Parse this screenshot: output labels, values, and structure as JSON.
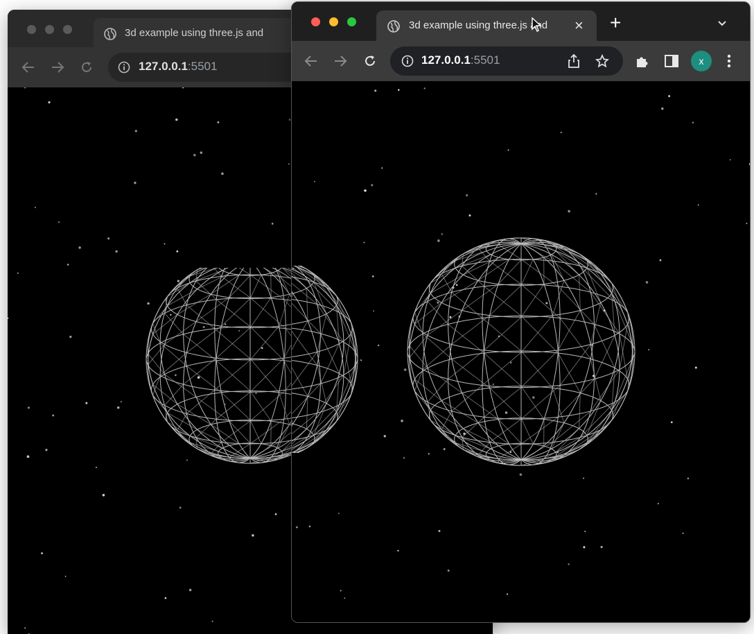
{
  "windows": {
    "back": {
      "tab_title": "3d example using three.js and",
      "url_host": "127.0.0.1",
      "url_port": ":5501"
    },
    "front": {
      "tab_title": "3d example using three.js and",
      "tab_close_glyph": "×",
      "new_tab_glyph": "+",
      "url_host": "127.0.0.1",
      "url_port": ":5501",
      "profile_initial": "x"
    }
  },
  "colors": {
    "close": "#ff5f57",
    "minimize": "#febc2e",
    "maximize": "#28c840",
    "profile": "#1e8e7e",
    "wireframe": "#e8e8e8"
  },
  "icons": [
    "globe-icon",
    "close-icon",
    "plus-icon",
    "chevron-down-icon",
    "back-arrow-icon",
    "forward-arrow-icon",
    "reload-icon",
    "info-icon",
    "share-icon",
    "star-icon",
    "extensions-icon",
    "side-panel-icon",
    "menu-icon",
    "cursor-icon"
  ]
}
